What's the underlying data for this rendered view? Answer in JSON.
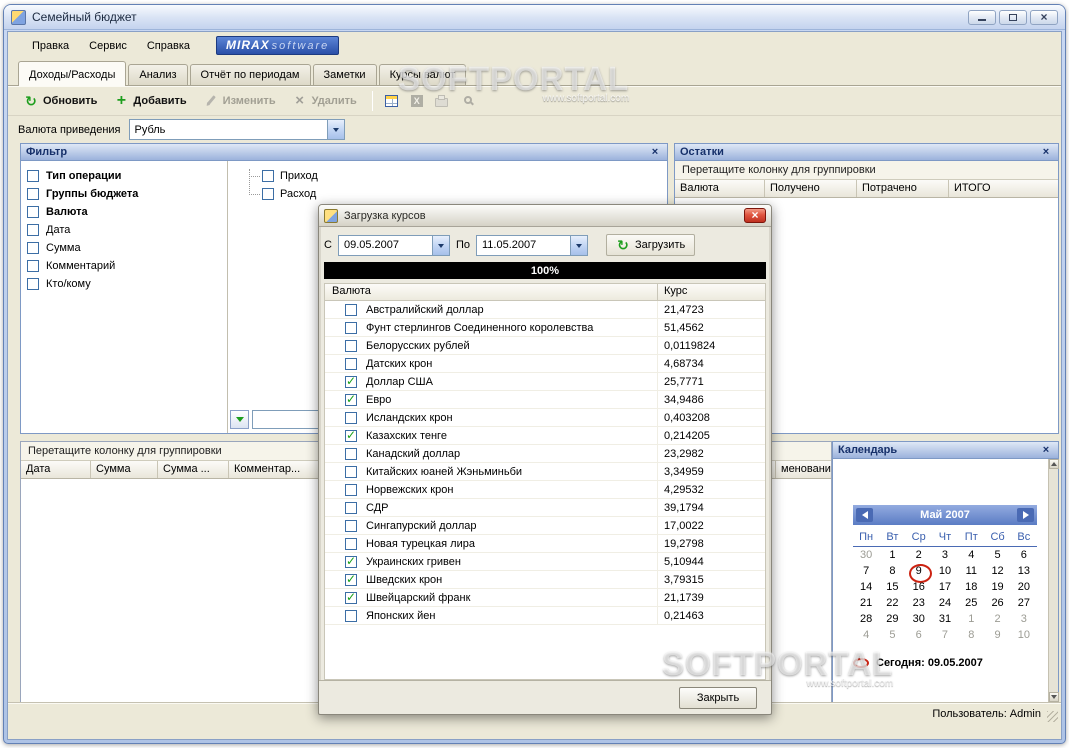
{
  "window": {
    "title": "Семейный бюджет",
    "statusbar": {
      "user": "Пользователь: Admin"
    }
  },
  "menubar": {
    "items": [
      "Правка",
      "Сервис",
      "Справка"
    ],
    "logo": {
      "part1": "MIRAX",
      "part2": "software"
    }
  },
  "tabs": [
    {
      "label": "Доходы/Расходы",
      "active": true
    },
    {
      "label": "Анализ"
    },
    {
      "label": "Отчёт по периодам"
    },
    {
      "label": "Заметки"
    },
    {
      "label": "Курсы валют"
    }
  ],
  "toolbar": {
    "buttons": [
      {
        "label": "Обновить",
        "icon": "refresh-icon",
        "enabled": true
      },
      {
        "label": "Добавить",
        "icon": "add-icon",
        "enabled": true
      },
      {
        "label": "Изменить",
        "icon": "edit-icon",
        "enabled": false
      },
      {
        "label": "Удалить",
        "icon": "delete-icon",
        "enabled": false
      }
    ],
    "icon_buttons": [
      "table-icon",
      "excel-icon",
      "print-icon",
      "preview-icon"
    ]
  },
  "currency": {
    "label": "Валюта приведения",
    "value": "Рубль"
  },
  "filter_panel": {
    "title": "Фильтр",
    "tree": [
      {
        "label": "Тип операции",
        "bold": true
      },
      {
        "label": "Группы бюджета",
        "bold": true
      },
      {
        "label": "Валюта",
        "bold": true
      },
      {
        "label": "Дата"
      },
      {
        "label": "Сумма"
      },
      {
        "label": "Комментарий"
      },
      {
        "label": "Кто/кому"
      }
    ],
    "operations": [
      {
        "label": "Приход"
      },
      {
        "label": "Расход"
      }
    ]
  },
  "balances_panel": {
    "title": "Остатки",
    "group_hint": "Перетащите колонку для группировки",
    "columns": [
      "Валюта",
      "Получено",
      "Потрачено",
      "ИТОГО"
    ]
  },
  "transactions_panel": {
    "group_hint": "Перетащите колонку для группировки",
    "columns": [
      "Дата",
      "Сумма",
      "Сумма ...",
      "Комментар...",
      "",
      "менование"
    ]
  },
  "dialog": {
    "title": "Загрузка курсов",
    "from_label": "С",
    "from_value": "09.05.2007",
    "to_label": "По",
    "to_value": "11.05.2007",
    "load_button": "Загрузить",
    "progress": "100%",
    "columns": {
      "currency": "Валюта",
      "rate": "Курс"
    },
    "rows": [
      {
        "name": "Австралийский доллар",
        "rate": "21,4723",
        "checked": false
      },
      {
        "name": "Фунт стерлингов Соединенного королевства",
        "rate": "51,4562",
        "checked": false
      },
      {
        "name": "Белорусских рублей",
        "rate": "0,0119824",
        "checked": false
      },
      {
        "name": "Датских крон",
        "rate": "4,68734",
        "checked": false
      },
      {
        "name": "Доллар США",
        "rate": "25,7771",
        "checked": true
      },
      {
        "name": "Евро",
        "rate": "34,9486",
        "checked": true
      },
      {
        "name": "Исландских крон",
        "rate": "0,403208",
        "checked": false
      },
      {
        "name": "Казахских тенге",
        "rate": "0,214205",
        "checked": true
      },
      {
        "name": "Канадский доллар",
        "rate": "23,2982",
        "checked": false
      },
      {
        "name": "Китайских юаней Жэньминьби",
        "rate": "3,34959",
        "checked": false
      },
      {
        "name": "Норвежских крон",
        "rate": "4,29532",
        "checked": false
      },
      {
        "name": "СДР",
        "rate": "39,1794",
        "checked": false
      },
      {
        "name": "Сингапурский доллар",
        "rate": "17,0022",
        "checked": false
      },
      {
        "name": "Новая турецкая лира",
        "rate": "19,2798",
        "checked": false
      },
      {
        "name": "Украинских гривен",
        "rate": "5,10944",
        "checked": true
      },
      {
        "name": "Шведских крон",
        "rate": "3,79315",
        "checked": true
      },
      {
        "name": "Швейцарский франк",
        "rate": "21,1739",
        "checked": true
      },
      {
        "name": "Японских йен",
        "rate": "0,21463",
        "checked": false
      }
    ],
    "close_button": "Закрыть"
  },
  "calendar_panel": {
    "title": "Календарь",
    "month": "Май 2007",
    "weekdays": [
      "Пн",
      "Вт",
      "Ср",
      "Чт",
      "Пт",
      "Сб",
      "Вс"
    ],
    "cells": [
      {
        "d": "30",
        "muted": true
      },
      {
        "d": "1"
      },
      {
        "d": "2"
      },
      {
        "d": "3"
      },
      {
        "d": "4"
      },
      {
        "d": "5"
      },
      {
        "d": "6"
      },
      {
        "d": "7"
      },
      {
        "d": "8"
      },
      {
        "d": "9",
        "circled": true
      },
      {
        "d": "10"
      },
      {
        "d": "11"
      },
      {
        "d": "12"
      },
      {
        "d": "13"
      },
      {
        "d": "14"
      },
      {
        "d": "15"
      },
      {
        "d": "16"
      },
      {
        "d": "17"
      },
      {
        "d": "18"
      },
      {
        "d": "19"
      },
      {
        "d": "20"
      },
      {
        "d": "21"
      },
      {
        "d": "22"
      },
      {
        "d": "23"
      },
      {
        "d": "24"
      },
      {
        "d": "25"
      },
      {
        "d": "26"
      },
      {
        "d": "27"
      },
      {
        "d": "28"
      },
      {
        "d": "29"
      },
      {
        "d": "30"
      },
      {
        "d": "31"
      },
      {
        "d": "1",
        "muted": true
      },
      {
        "d": "2",
        "muted": true
      },
      {
        "d": "3",
        "muted": true
      },
      {
        "d": "4",
        "muted": true
      },
      {
        "d": "5",
        "muted": true
      },
      {
        "d": "6",
        "muted": true
      },
      {
        "d": "7",
        "muted": true
      },
      {
        "d": "8",
        "muted": true
      },
      {
        "d": "9",
        "muted": true
      },
      {
        "d": "10",
        "muted": true
      }
    ],
    "today": "Сегодня: 09.05.2007"
  },
  "watermark": {
    "text": "SOFTPORTAL",
    "url": "www.softportal.com"
  },
  "icons": {
    "refresh-icon": "↻ green",
    "add-icon": "+ green",
    "edit-icon": "pencil gray",
    "delete-icon": "× gray",
    "table-icon": "grid shape",
    "excel-icon": "X on square",
    "print-icon": "printer shape",
    "preview-icon": "magnifier shape",
    "close-icon": "×",
    "dropdown-icon": "▼",
    "prev-month-icon": "left triangle",
    "next-month-icon": "right triangle",
    "today-marker-icon": "red ellipse"
  },
  "colors": {
    "panel_header_text": "#16306a",
    "check_green": "#18a018",
    "close_red": "#c03020",
    "progress_bg": "#000000",
    "calendar_accent": "#4a6ab4"
  }
}
